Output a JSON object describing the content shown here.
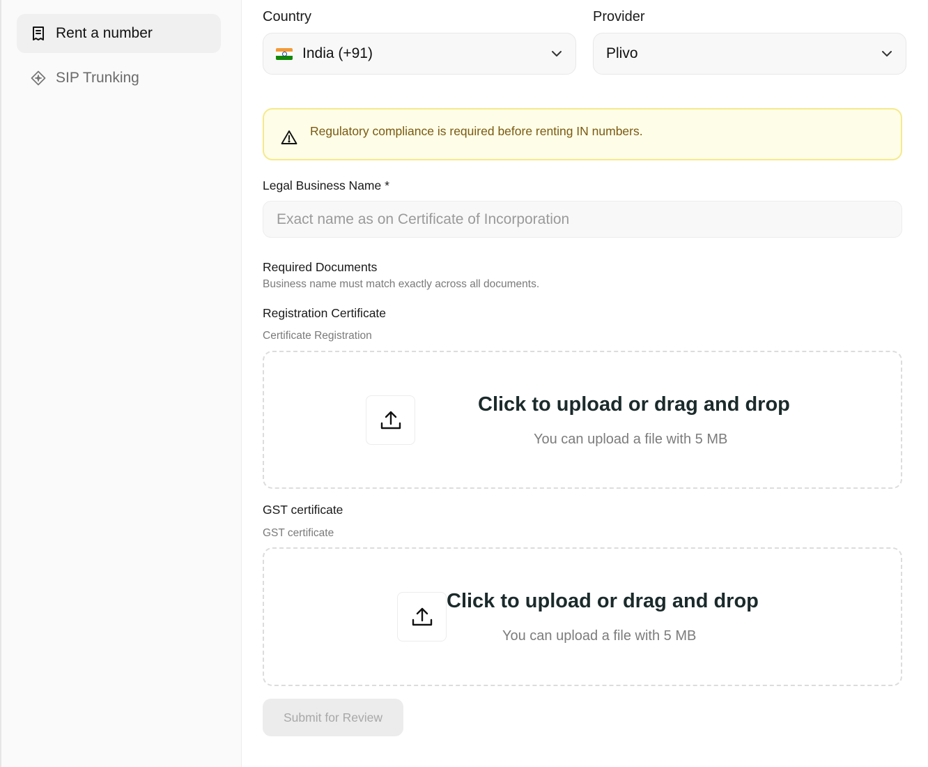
{
  "sidebar": {
    "items": [
      {
        "label": "Rent a number",
        "icon": "receipt-icon",
        "active": true
      },
      {
        "label": "SIP Trunking",
        "icon": "diamond-nodes-icon",
        "active": false
      }
    ]
  },
  "form": {
    "country": {
      "label": "Country",
      "value": "India (+91)"
    },
    "provider": {
      "label": "Provider",
      "value": "Plivo"
    },
    "alert": {
      "text": "Regulatory compliance is required before renting IN numbers."
    },
    "business_name": {
      "label": "Legal Business Name *",
      "placeholder": "Exact name as on Certificate of Incorporation"
    },
    "required_docs": {
      "title": "Required Documents",
      "subtitle": "Business name must match exactly across all documents."
    },
    "documents": [
      {
        "title": "Registration Certificate",
        "subtitle": "Certificate Registration",
        "upload_title": "Click to upload or drag and drop",
        "upload_sub": "You can upload a file with 5 MB"
      },
      {
        "title": "GST certificate",
        "subtitle": "GST certificate",
        "upload_title": "Click to upload or drag and drop",
        "upload_sub": "You can upload a file with 5 MB"
      }
    ],
    "submit_label": "Submit for Review"
  },
  "colors": {
    "alert_bg": "#fefde8",
    "alert_border": "#f5ea8a",
    "alert_text": "#7a5a10"
  }
}
